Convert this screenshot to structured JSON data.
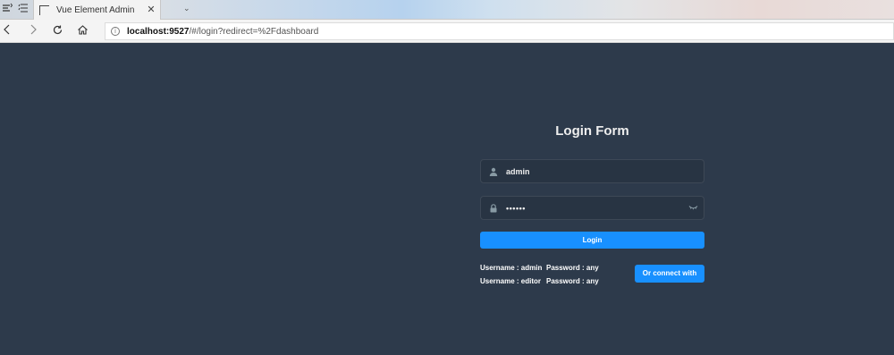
{
  "browser": {
    "tab_title": "Vue Element Admin",
    "url_host": "localhost:9527",
    "url_path": "/#/login?redirect=%2Fdashboard"
  },
  "login": {
    "title": "Login Form",
    "username_value": "admin",
    "password_mask": "••••••",
    "login_label": "Login",
    "tips": [
      {
        "user": "Username : admin",
        "pass": "Password : any"
      },
      {
        "user": "Username : editor",
        "pass": "Password : any"
      }
    ],
    "thirdparty_label": "Or connect with"
  },
  "colors": {
    "background": "#2d3a4b",
    "input_bg": "#283443",
    "accent": "#1890ff",
    "text": "#eeeeee",
    "icon": "#889aa4"
  },
  "icons": {
    "user": "user-icon",
    "password": "lock-icon",
    "eye": "eye-closed-icon"
  }
}
